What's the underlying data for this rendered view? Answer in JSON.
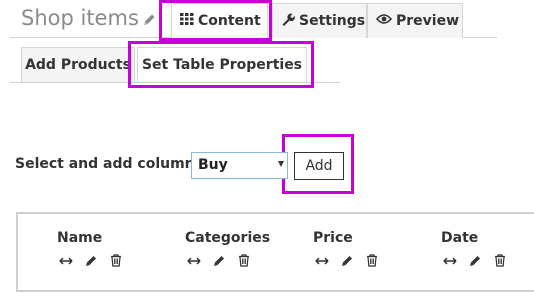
{
  "header": {
    "title": "Shop items"
  },
  "tabs": [
    {
      "label": "Content",
      "icon": "grid-icon",
      "active": true
    },
    {
      "label": "Settings",
      "icon": "wrench-icon",
      "active": false
    },
    {
      "label": "Preview",
      "icon": "eye-icon",
      "active": false
    }
  ],
  "subtabs": [
    {
      "label": "Add Products",
      "active": false
    },
    {
      "label": "Set Table Properties",
      "active": true
    }
  ],
  "column_picker": {
    "label": "Select and add columns:",
    "selected": "Buy",
    "add_label": "Add"
  },
  "columns": [
    {
      "name": "Name"
    },
    {
      "name": "Categories"
    },
    {
      "name": "Price"
    },
    {
      "name": "Date"
    }
  ],
  "colors": {
    "highlight": "#c800d8",
    "select_border": "#8fb8d8"
  }
}
